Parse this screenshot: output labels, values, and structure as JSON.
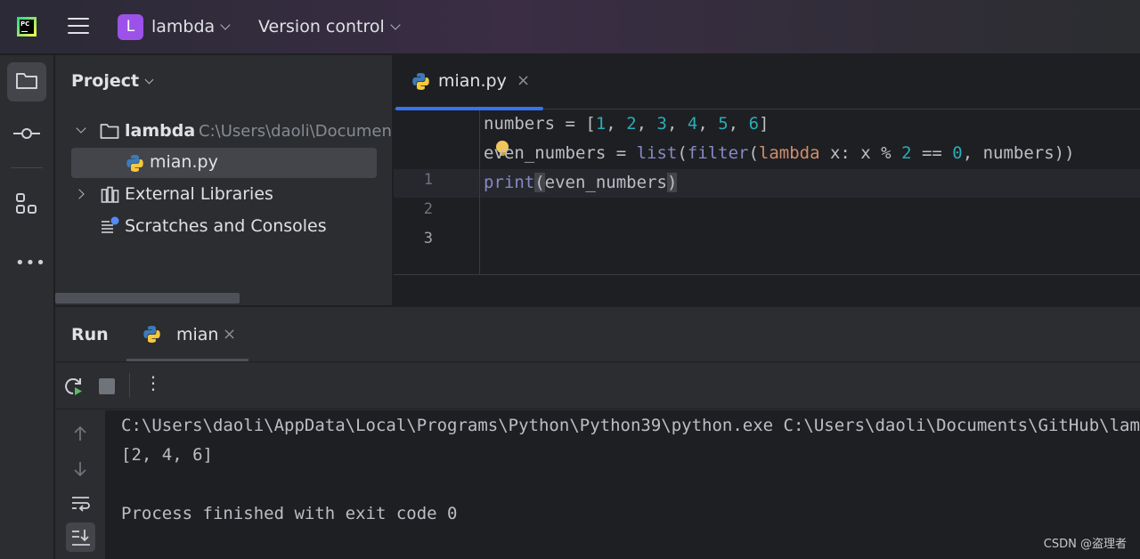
{
  "titlebar": {
    "project_badge": "L",
    "project_name": "lambda",
    "version_control": "Version control"
  },
  "project_panel": {
    "title": "Project",
    "tree": {
      "root_name": "lambda",
      "root_path": "C:\\Users\\daoli\\Documents\\GitHub",
      "file": "mian.py",
      "external_libraries": "External Libraries",
      "scratches": "Scratches and Consoles"
    }
  },
  "editor": {
    "tab_label": "mian.py",
    "tab_close": "×",
    "line_numbers": [
      "1",
      "2",
      "3"
    ],
    "code": {
      "l1": {
        "a": "numbers = [",
        "n1": "1",
        "s1": ", ",
        "n2": "2",
        "s2": ", ",
        "n3": "3",
        "s3": ", ",
        "n4": "4",
        "s4": ", ",
        "n5": "5",
        "s5": ", ",
        "n6": "6",
        "end": "]"
      },
      "l2": {
        "a": "even_numbers = ",
        "list": "list",
        "p1": "(",
        "filter": "filter",
        "p2": "(",
        "lambda": "lambda",
        "b": " x: x % ",
        "two": "2",
        "c": " == ",
        "zero": "0",
        "d": ", numbers))"
      },
      "l3": {
        "print": "print",
        "open": "(",
        "arg": "even_numbers",
        "close": ")"
      }
    }
  },
  "run_panel": {
    "title": "Run",
    "tab_label": "mian",
    "tab_close": "×",
    "console": [
      "C:\\Users\\daoli\\AppData\\Local\\Programs\\Python\\Python39\\python.exe C:\\Users\\daoli\\Documents\\GitHub\\lambda\\mian.py",
      "[2, 4, 6]",
      "",
      "Process finished with exit code 0"
    ]
  },
  "watermark": "CSDN @盗理者",
  "icons": {
    "app": "pycharm-logo-icon",
    "menu": "hamburger-menu-icon",
    "project_tool": "folder-icon",
    "commit_tool": "commit-icon",
    "structure_tool": "structure-icon",
    "more": "more-horizontal-icon",
    "python_file": "python-file-icon",
    "rerun": "rerun-icon",
    "stop": "stop-icon"
  },
  "colors": {
    "accent": "#3574f0",
    "project_badge": "#9c52e8",
    "number": "#2aacb8",
    "builtin": "#8888c6",
    "keyword": "#cf8e6d"
  }
}
